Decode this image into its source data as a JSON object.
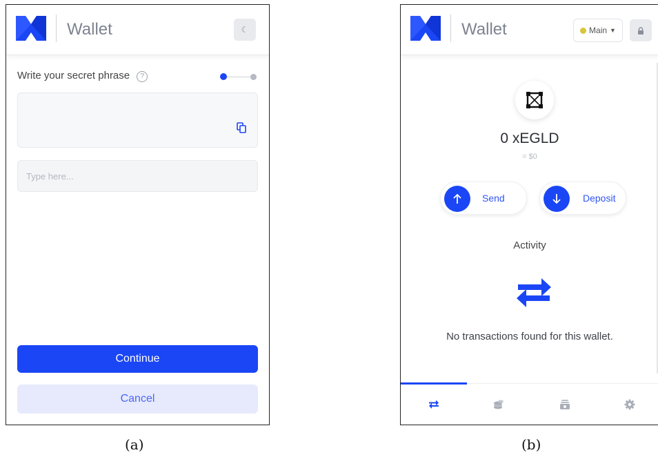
{
  "panel_a": {
    "header": {
      "title": "Wallet",
      "theme_toggle_icon": "moon-icon"
    },
    "secret_phrase": {
      "title": "Write your secret phrase",
      "help_icon": "help-circle-icon",
      "copy_icon": "copy-icon"
    },
    "step": {
      "current": 1,
      "total": 2
    },
    "input": {
      "value": "",
      "placeholder": "Type here..."
    },
    "buttons": {
      "continue": "Continue",
      "cancel": "Cancel"
    },
    "caption": "(a)"
  },
  "panel_b": {
    "header": {
      "title": "Wallet",
      "network": "Main",
      "network_dot_color": "#d8c53a",
      "lock_icon": "lock-icon"
    },
    "token_icon": "egld-token-icon",
    "balance": "0 xEGLD",
    "balance_usd": "= $0",
    "actions": {
      "send": "Send",
      "deposit": "Deposit"
    },
    "activity": {
      "title": "Activity",
      "empty_icon": "swap-arrows-icon",
      "empty_message": "No transactions found for this wallet."
    },
    "bottom_nav": [
      {
        "icon": "transactions-icon",
        "active": true
      },
      {
        "icon": "coins-icon",
        "active": false
      },
      {
        "icon": "nft-icon",
        "active": false
      },
      {
        "icon": "settings-icon",
        "active": false
      }
    ],
    "caption": "(b)"
  },
  "colors": {
    "accent": "#1b46f5",
    "cancel_bg": "#e7eafd"
  }
}
